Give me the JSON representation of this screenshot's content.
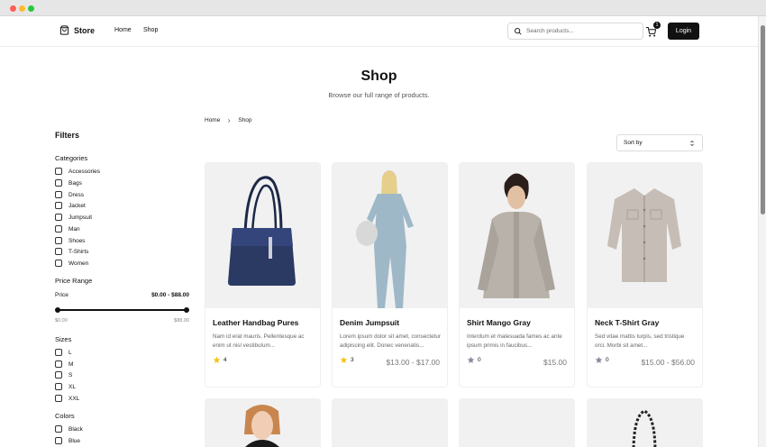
{
  "brand": {
    "name": "Store"
  },
  "nav": {
    "home": "Home",
    "shop": "Shop"
  },
  "search": {
    "placeholder": "Search products..."
  },
  "cart": {
    "count": "1"
  },
  "login": {
    "label": "Login"
  },
  "hero": {
    "title": "Shop",
    "subtitle": "Browse our full range of products."
  },
  "breadcrumb": {
    "home": "Home",
    "current": "Shop"
  },
  "sort": {
    "label": "Sort by"
  },
  "filters": {
    "title": "Filters",
    "categories": {
      "title": "Categories",
      "items": [
        "Accessories",
        "Bags",
        "Dress",
        "Jacket",
        "Jumpsuit",
        "Man",
        "Shoes",
        "T-Shirts",
        "Women"
      ]
    },
    "price": {
      "title": "Price Range",
      "label": "Price",
      "value": "$0.00 - $88.00",
      "min_label": "$0.00",
      "max_label": "$88.00"
    },
    "sizes": {
      "title": "Sizes",
      "items": [
        "L",
        "M",
        "S",
        "XL",
        "XXL"
      ]
    },
    "colors": {
      "title": "Colors",
      "items": [
        "Black",
        "Blue"
      ]
    }
  },
  "products": [
    {
      "name": "Leather Handbag Pures",
      "description": "Nam id erat mauris. Pellentesque ac enim ut nisl vestibulum...",
      "rating": "4",
      "price": "",
      "rated": true
    },
    {
      "name": "Denim Jumpsuit",
      "description": "Lorem ipsum dolor sit amet, consectetur adipiscing elit. Donec venenatis...",
      "rating": "3",
      "price": "$13.00 - $17.00",
      "rated": true
    },
    {
      "name": "Shirt Mango Gray",
      "description": "Interdum et malesuada fames ac ante ipsum primis in faucibus...",
      "rating": "0",
      "price": "$15.00",
      "rated": false
    },
    {
      "name": "Neck T-Shirt Gray",
      "description": "Sed vitae mattis turpis, sed tristique orci. Morbi sit amet...",
      "rating": "0",
      "price": "$15.00 - $56.00",
      "rated": false
    }
  ],
  "colors": {
    "accent": "#111111",
    "star_filled": "#f5c518",
    "star_empty": "#8a8a9a"
  }
}
